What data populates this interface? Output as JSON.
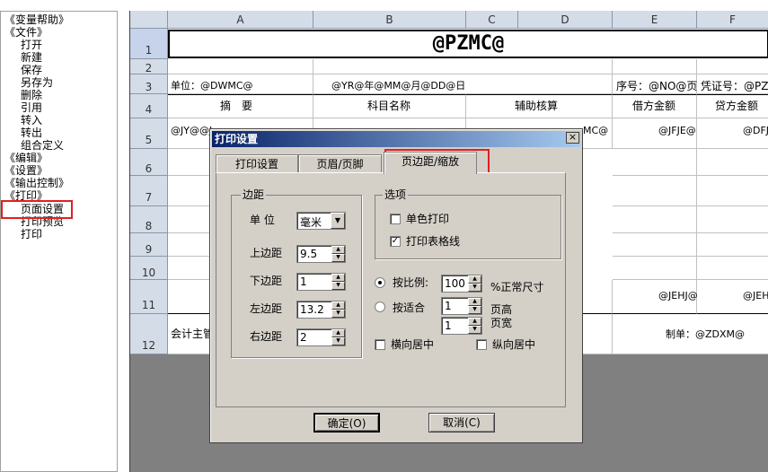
{
  "tree": {
    "items": [
      {
        "label": "《变量帮助》"
      },
      {
        "label": "《文件》"
      },
      {
        "label": "打开"
      },
      {
        "label": "新建"
      },
      {
        "label": "保存"
      },
      {
        "label": "另存为"
      },
      {
        "label": "删除"
      },
      {
        "label": "引用"
      },
      {
        "label": "转入"
      },
      {
        "label": "转出"
      },
      {
        "label": "组合定义"
      },
      {
        "label": "《编辑》"
      },
      {
        "label": "《设置》"
      },
      {
        "label": "《输出控制》"
      },
      {
        "label": "《打印》"
      },
      {
        "label": "页面设置"
      },
      {
        "label": "打印预览"
      },
      {
        "label": "打印"
      }
    ]
  },
  "sheet": {
    "columns": [
      "A",
      "B",
      "C",
      "D",
      "E",
      "F"
    ],
    "rows": [
      "1",
      "2",
      "3",
      "4",
      "5",
      "6",
      "7",
      "8",
      "9",
      "10",
      "11",
      "12"
    ],
    "title": "@PZMC@",
    "r3": {
      "a": "单位：@DWMC@",
      "b": "@YR@年@MM@月@DD@日",
      "e": "序号：@NO@页",
      "f": "凭证号：@PZBH"
    },
    "r4": {
      "a": "摘　要",
      "b": "科目名称",
      "c": "辅助核算",
      "e": "借方金额",
      "f": "贷方金额"
    },
    "r5": {
      "a": "@JY@@J",
      "d": "MC@",
      "e": "@JFJE@",
      "f": "@DFJ"
    },
    "r11": {
      "e": "@JEHJ@",
      "f": "@JEH"
    },
    "r12": {
      "a": "会计主管",
      "e": "制单：@ZDXM@"
    }
  },
  "dialog": {
    "title": "打印设置",
    "tabs": [
      "打印设置",
      "页眉/页脚",
      "页边距/缩放"
    ],
    "margins": {
      "group_title": "边距",
      "unit_label": "单 位",
      "unit_value": "毫米",
      "top_label": "上边距",
      "top_value": "9.5",
      "bottom_label": "下边距",
      "bottom_value": "1",
      "left_label": "左边距",
      "left_value": "13.2",
      "right_label": "右边距",
      "right_value": "2"
    },
    "options": {
      "group_title": "选项",
      "mono_label": "单色打印",
      "mono_checked": false,
      "grid_label": "打印表格线",
      "grid_checked": true
    },
    "scale": {
      "ratio_label": "按比例:",
      "ratio_value": "100",
      "ratio_unit": "%正常尺寸",
      "ratio_selected": true,
      "fit_label": "按适合",
      "fit_selected": false,
      "fit_height_value": "1",
      "fit_height_label": "页高",
      "fit_width_value": "1",
      "fit_width_label": "页宽",
      "hcenter_label": "横向居中",
      "hcenter_checked": false,
      "vcenter_label": "纵向居中",
      "vcenter_checked": false
    },
    "ok_label": "确定(O)",
    "cancel_label": "取消(C)",
    "highlight_color": "#e02020"
  }
}
